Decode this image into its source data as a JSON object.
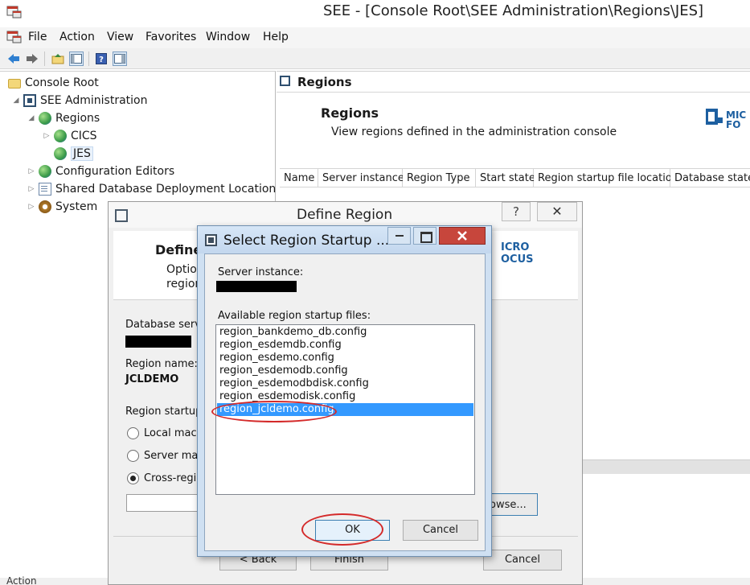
{
  "window": {
    "title": "SEE - [Console Root\\SEE Administration\\Regions\\JES]"
  },
  "menu": [
    "File",
    "Action",
    "View",
    "Favorites",
    "Window",
    "Help"
  ],
  "toolbar_icons": [
    "back-icon",
    "forward-icon",
    "up-folder-icon",
    "show-hide-tree-icon",
    "help-icon",
    "properties-icon"
  ],
  "tree": [
    {
      "label": "Console Root",
      "icon": "folder-icon"
    },
    {
      "label": "SEE Administration",
      "icon": "see-icon"
    },
    {
      "label": "Regions",
      "icon": "globe-icon"
    },
    {
      "label": "CICS",
      "icon": "globe-icon"
    },
    {
      "label": "JES",
      "icon": "globe-icon"
    },
    {
      "label": "Configuration Editors",
      "icon": "globe-icon"
    },
    {
      "label": "Shared Database Deployment Locations",
      "icon": "document-icon"
    },
    {
      "label": "System",
      "icon": "gear-icon"
    }
  ],
  "right_pane": {
    "header": "Regions",
    "banner_title": "Regions",
    "banner_desc": "View regions defined in the administration console",
    "logo_text": [
      "MIC",
      "FO"
    ],
    "columns": [
      "Name",
      "Server instance",
      "Region Type",
      "Start state",
      "Region startup file location",
      "Database state"
    ]
  },
  "status_text": "Action",
  "define_region": {
    "title": "Define Region",
    "help_glyph": "?",
    "close_glyph": "✕",
    "heading": "Define",
    "sub1": "Optio",
    "sub2": "region",
    "logo_text": [
      "ICRO",
      "OCUS"
    ],
    "db_server_label": "Database serv",
    "region_name_label": "Region name:",
    "region_name_value": "JCLDEMO",
    "startup_label": "Region startup",
    "options": [
      "Local mach",
      "Server mac",
      "Cross-regio"
    ],
    "selected_option": 2,
    "browse_label": "rowse...",
    "back_label": "< Back",
    "finish_label": "Finish",
    "cancel_label": "Cancel"
  },
  "select_dialog": {
    "title": "Select Region Startup ...",
    "server_instance_label": "Server instance:",
    "available_label": "Available region startup files:",
    "files": [
      "region_bankdemo_db.config",
      "region_esdemdb.config",
      "region_esdemo.config",
      "region_esdemodb.config",
      "region_esdemodbdisk.config",
      "region_esdemodisk.config",
      "region_jcldemo.config"
    ],
    "selected_index": 6,
    "ok_label": "OK",
    "cancel_label": "Cancel"
  },
  "colors": {
    "selection": "#3399ff",
    "annotation": "#d42a2a",
    "close_button": "#c7463c",
    "dialog_frame": "#cfe0f2"
  }
}
